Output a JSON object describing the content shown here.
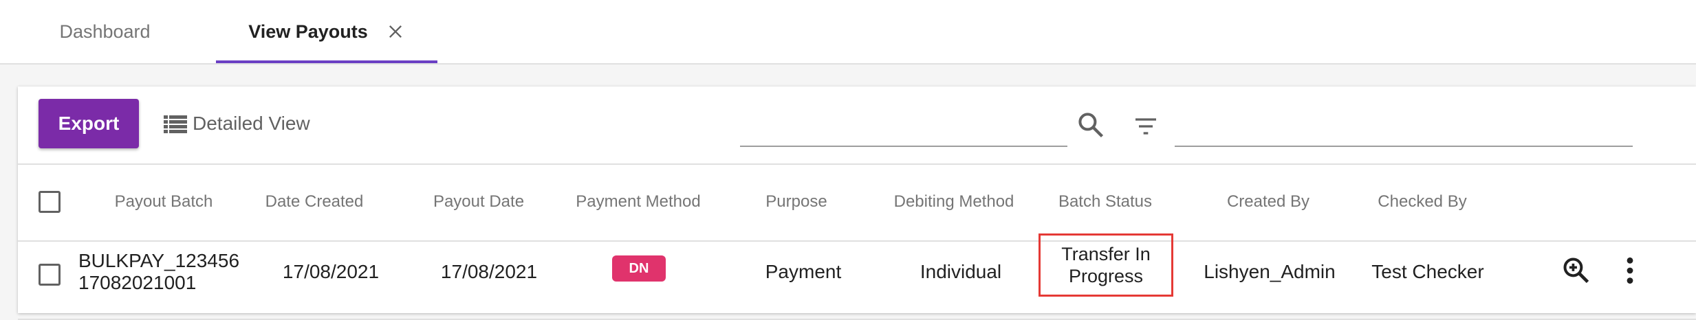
{
  "tabs": [
    {
      "label": "Dashboard",
      "active": false
    },
    {
      "label": "View Payouts",
      "active": true,
      "closable": true
    }
  ],
  "colors": {
    "accent": "#6a3fc4",
    "export_button": "#7b2ba8",
    "dn_badge": "#e0336c",
    "status_highlight": "#e53935"
  },
  "toolbar": {
    "export_label": "Export",
    "detailed_view_label": "Detailed View",
    "search_placeholder": "",
    "filter_placeholder": "",
    "icons": [
      "list-icon",
      "search-icon",
      "filter-icon"
    ]
  },
  "table": {
    "columns": [
      "Payout Batch",
      "Date Created",
      "Payout Date",
      "Payment Method",
      "Purpose",
      "Debiting Method",
      "Batch Status",
      "Created By",
      "Checked By"
    ],
    "rows": [
      {
        "payout_batch_line1": "BULKPAY_123456",
        "payout_batch_line2": "17082021001",
        "date_created": "17/08/2021",
        "payout_date": "17/08/2021",
        "payment_method": "DN",
        "purpose": "Payment",
        "debiting_method": "Individual",
        "batch_status_line1": "Transfer In",
        "batch_status_line2": "Progress",
        "created_by": "Lishyen_Admin",
        "checked_by": "Test Checker",
        "actions": [
          "zoom-in-icon",
          "more-vert-icon"
        ]
      }
    ]
  }
}
